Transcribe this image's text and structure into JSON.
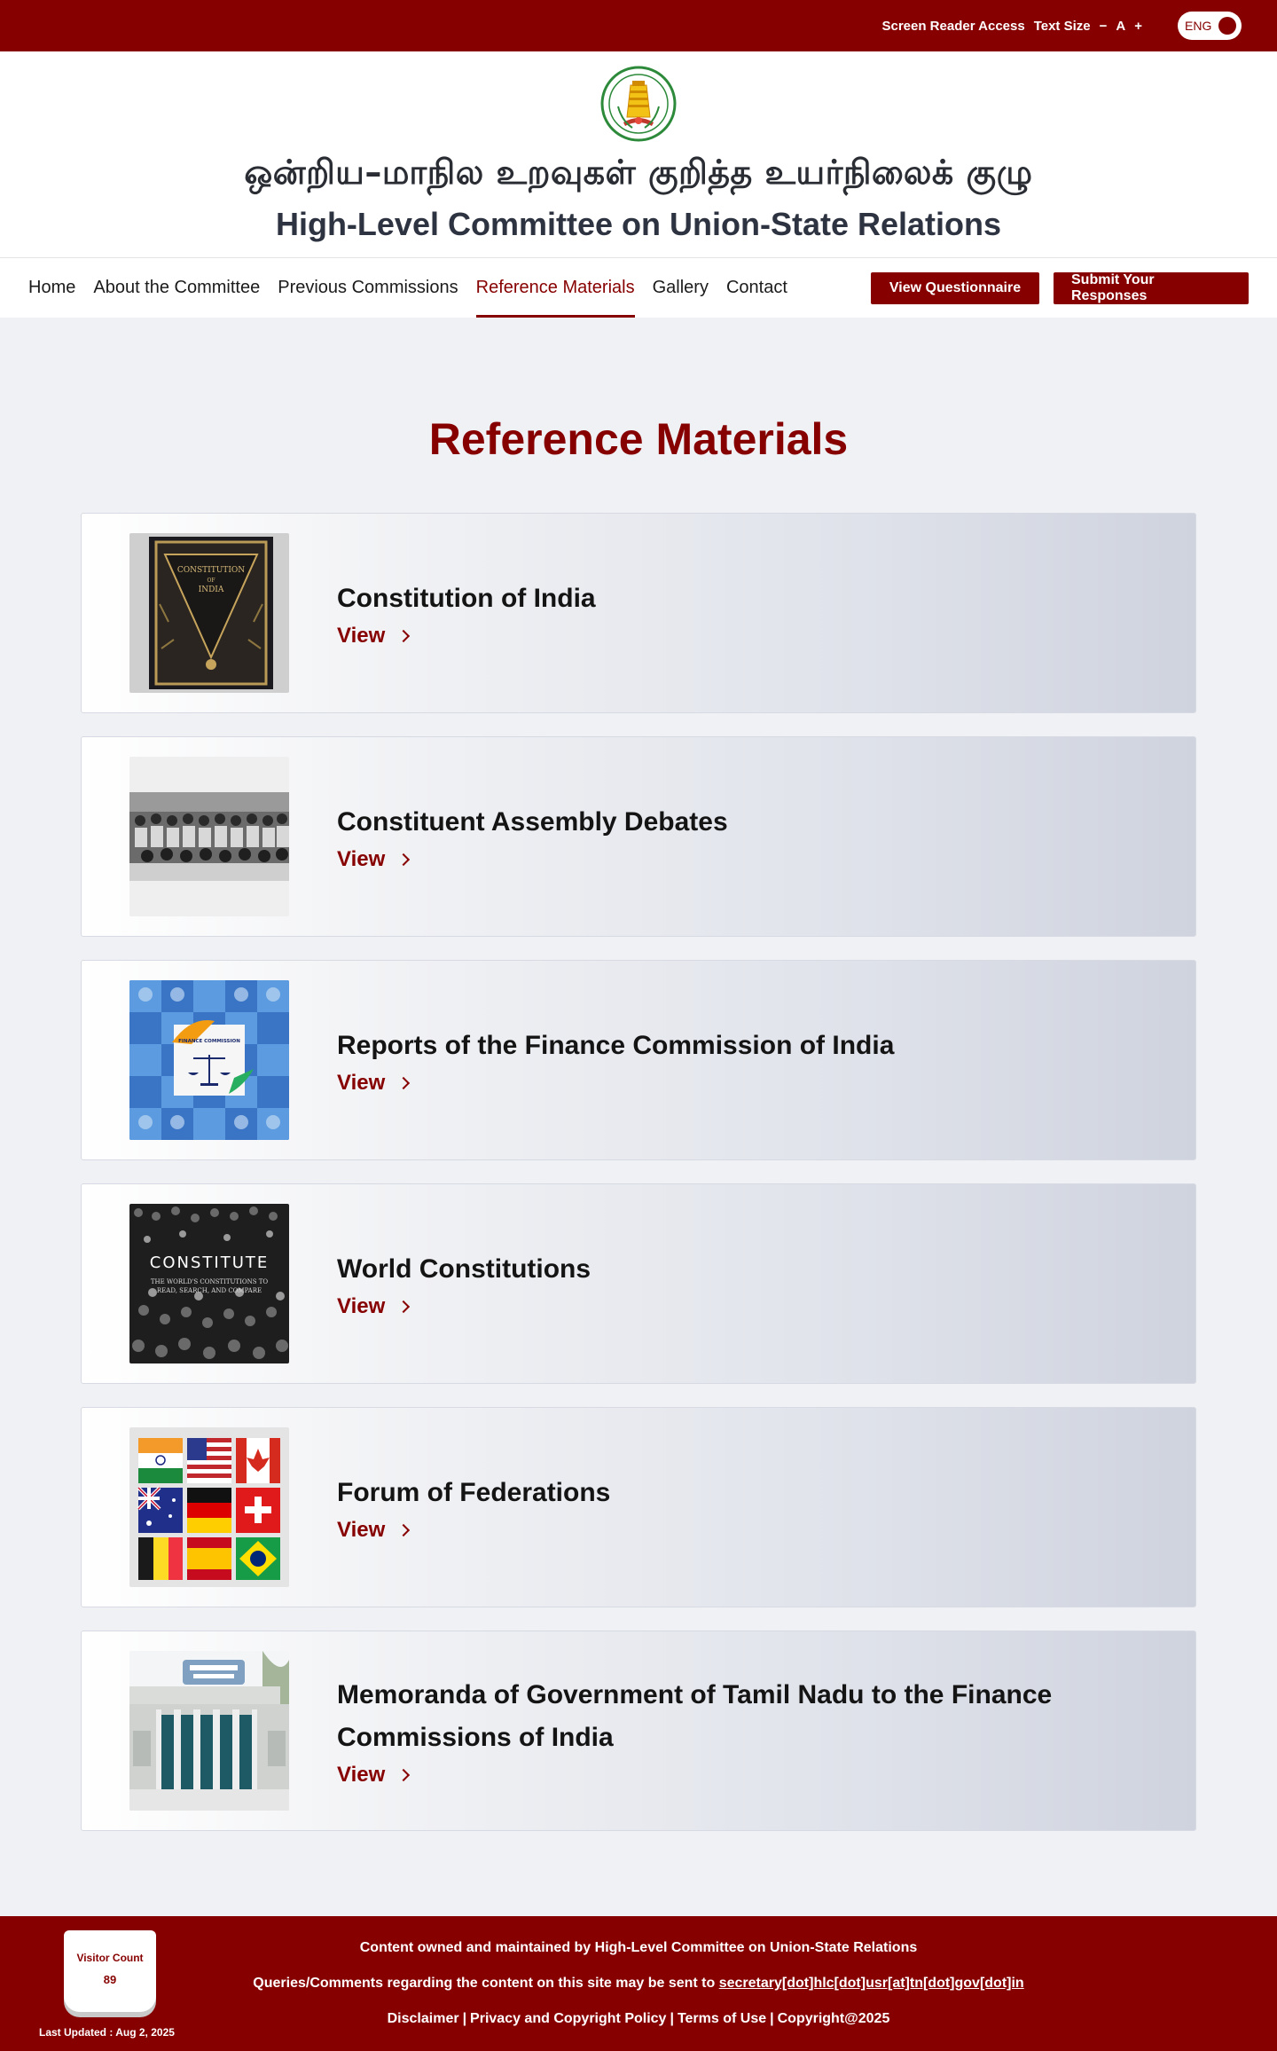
{
  "topbar": {
    "screen_reader": "Screen Reader Access",
    "text_size": "Text Size",
    "decrease": "−",
    "normal": "A",
    "increase": "+",
    "language": "ENG"
  },
  "header": {
    "tamil_title": "ஒன்றிய–மாநில உறவுகள் குறித்த  உயர்நிலைக் குழு",
    "english_title": "High-Level Committee on Union-State Relations"
  },
  "nav": {
    "links": [
      "Home",
      "About the Committee",
      "Previous Commissions",
      "Reference Materials",
      "Gallery",
      "Contact"
    ],
    "active": "Reference Materials",
    "buttons": [
      "View Questionnaire",
      "Submit Your Responses"
    ]
  },
  "main": {
    "heading": "Reference Materials",
    "cards": [
      {
        "title": "Constitution of India",
        "link": "View"
      },
      {
        "title": "Constituent Assembly Debates",
        "link": "View"
      },
      {
        "title": "Reports of the Finance Commission of India",
        "link": "View"
      },
      {
        "title": "World Constitutions",
        "link": "View"
      },
      {
        "title": "Forum of Federations",
        "link": "View"
      },
      {
        "title": "Memoranda of Government of Tamil Nadu to the Finance Commissions of India",
        "link": "View"
      }
    ]
  },
  "footer": {
    "visitor_label": "Visitor Count",
    "visitor_count": "89",
    "last_updated": "Last Updated : Aug 2, 2025",
    "line1": "Content owned and maintained by High-Level Committee on Union-State Relations",
    "line2_prefix": "Queries/Comments regarding the content on this site may be sent to ",
    "email": "secretary[dot]hlc[dot]usr[at]tn[dot]gov[dot]in",
    "links": [
      "Disclaimer",
      "Privacy and Copyright Policy",
      "Terms of Use",
      "Copyright@2025"
    ]
  },
  "colors": {
    "brand": "#870000",
    "page_bg": "#eff1f5"
  }
}
